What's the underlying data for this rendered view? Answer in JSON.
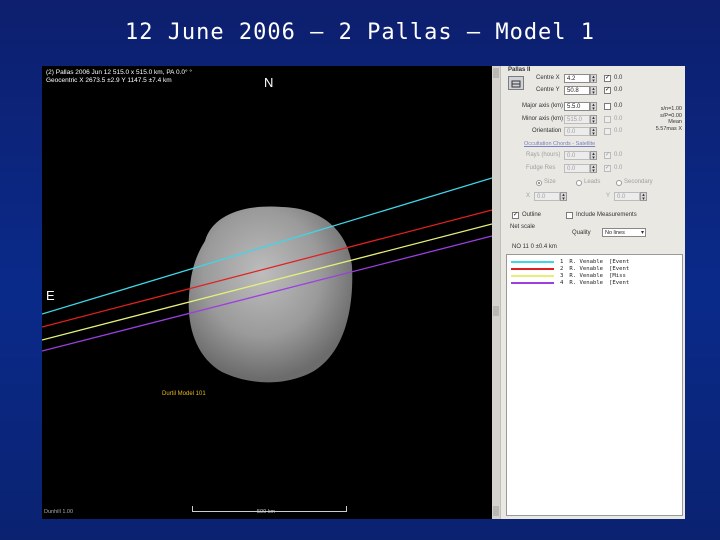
{
  "slide": {
    "title": "12 June 2006 – 2 Pallas – Model 1"
  },
  "viewport": {
    "info_line1": "(2) Pallas 2006 Jun 12  515.0 x 515.0 km, PA 0.0°  °",
    "info_line2": "Geocentric X 2673.5 ±2.9 Y 1147.5 ±7.4 km",
    "compass_north": "N",
    "compass_east": "E",
    "model_label": "Durtil Model 101",
    "scale_label": "500 km",
    "credit": "Dunhill 1.00",
    "chord_colors": [
      "#3fd6e8",
      "#e12020",
      "#e4f07a",
      "#9b3fe0"
    ]
  },
  "panel": {
    "title": "Pallas II",
    "center_x_label": "Centre X",
    "center_x_value": "4.2",
    "center_y_label": "Centre Y",
    "center_y_value": "50.8",
    "major_label": "Major axis (km)",
    "major_value": "5.5.0",
    "minor_label": "Minor axis (km)",
    "minor_value": "515.0",
    "orientation_label": "Orientation",
    "orientation_value": "0.0",
    "cb_values": [
      "0.0",
      "0.0",
      "0.0",
      "0.0",
      "0.0"
    ],
    "section_label": "Occultation Chords - Satellite",
    "sub1_label": "Rays (hours)",
    "sub1_value": "0.0",
    "sub2_label": "Fudge Res",
    "sub2_value": "0.0",
    "radio_labels": [
      "Size",
      "Leads",
      "Secondary"
    ],
    "x_label": "X",
    "x_value": "0.0",
    "y_label": "Y",
    "y_value": "0.0",
    "right_info": [
      "s/n=1.00",
      "s/P=0.00",
      "Mean",
      "5.57mas X"
    ],
    "check_outline": "Outline",
    "check_include": "Include Measurements",
    "net_scale_label": "Net scale",
    "dd_label": "Quality",
    "dd_value": "No lines",
    "list_header": "NO 11 0 ±0.4 km",
    "list_rows": [
      {
        "num": "1",
        "name": "R. Venable",
        "status": "[Event"
      },
      {
        "num": "2",
        "name": "R. Venable",
        "status": "[Event"
      },
      {
        "num": "3",
        "name": "R. Venable",
        "status": "[Miss"
      },
      {
        "num": "4",
        "name": "R. Venable",
        "status": "[Event"
      }
    ]
  }
}
